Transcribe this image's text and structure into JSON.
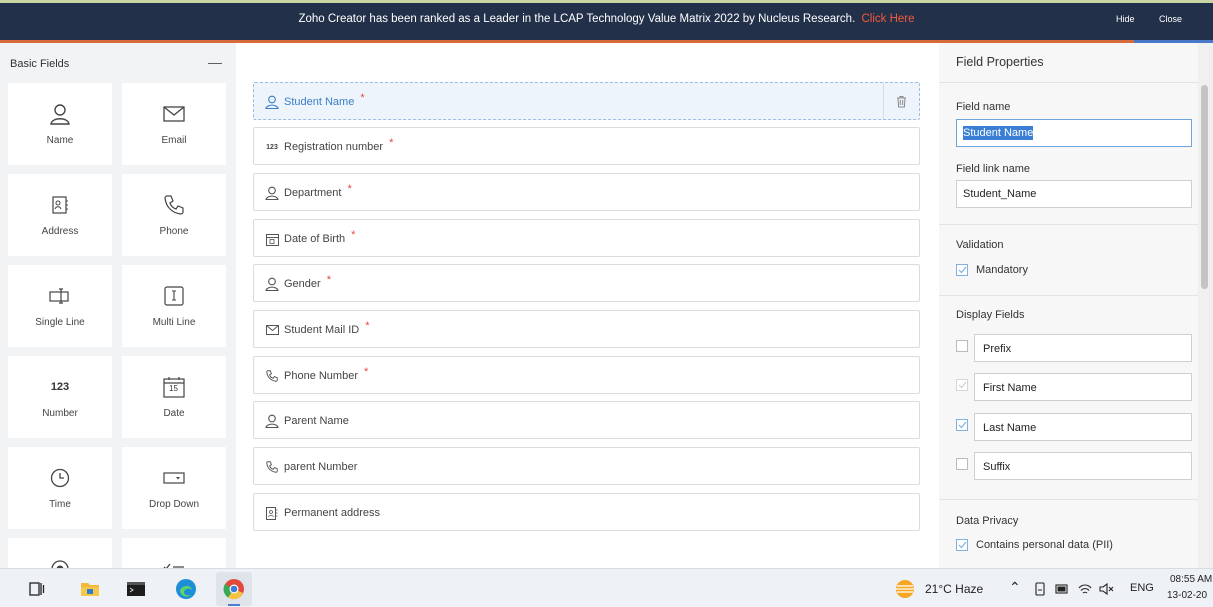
{
  "banner": {
    "message": "Zoho Creator has been ranked as a Leader in the LCAP Technology Value Matrix 2022 by Nucleus Research.",
    "link": "Click Here",
    "hide": "Hide",
    "close": "Close"
  },
  "palette": {
    "title": "Basic Fields",
    "collapse": "—",
    "items": [
      {
        "label": "Name",
        "icon": "person-icon"
      },
      {
        "label": "Email",
        "icon": "envelope-icon"
      },
      {
        "label": "Address",
        "icon": "address-book-icon"
      },
      {
        "label": "Phone",
        "icon": "phone-icon"
      },
      {
        "label": "Single Line",
        "icon": "single-line-icon"
      },
      {
        "label": "Multi Line",
        "icon": "multi-line-icon"
      },
      {
        "label": "Number",
        "icon_text": "123"
      },
      {
        "label": "Date",
        "icon_text": "15"
      },
      {
        "label": "Time",
        "icon": "clock-icon"
      },
      {
        "label": "Drop Down",
        "icon": "dropdown-icon"
      }
    ]
  },
  "form": {
    "fields": [
      {
        "label": "Student Name",
        "required": "*",
        "icon": "person-icon"
      },
      {
        "label": "Registration number",
        "required": "*",
        "icon_text": "123"
      },
      {
        "label": "Department",
        "required": "*",
        "icon": "person-icon"
      },
      {
        "label": "Date of Birth",
        "required": "*",
        "icon": "calendar-icon"
      },
      {
        "label": "Gender",
        "required": "*",
        "icon": "person-icon"
      },
      {
        "label": "Student Mail ID",
        "required": "*",
        "icon": "envelope-icon"
      },
      {
        "label": "Phone Number",
        "required": "*",
        "icon": "phone-icon"
      },
      {
        "label": "Parent Name",
        "required": "",
        "icon": "person-icon"
      },
      {
        "label": "parent Number",
        "required": "",
        "icon": "phone-icon"
      },
      {
        "label": "Permanent address",
        "required": "",
        "icon": "address-book-icon"
      }
    ]
  },
  "properties": {
    "title": "Field Properties",
    "field_name_label": "Field name",
    "field_name_value": "Student Name",
    "field_link_label": "Field link name",
    "field_link_value": "Student_Name",
    "validation_label": "Validation",
    "mandatory_label": "Mandatory",
    "display_fields_label": "Display Fields",
    "display_fields": [
      {
        "label": "Prefix",
        "checked": false
      },
      {
        "label": "First Name",
        "checked": true
      },
      {
        "label": "Last Name",
        "checked": true
      },
      {
        "label": "Suffix",
        "checked": false
      }
    ],
    "privacy_label": "Data Privacy",
    "pii_label": "Contains personal data (PII)"
  },
  "taskbar": {
    "weather": "21°C  Haze",
    "language": "ENG",
    "time": "08:55 AM",
    "date": "13-02-20"
  },
  "colors": {
    "accent": "#3a7fc8",
    "banner": "#23304a",
    "required": "#e04848"
  }
}
